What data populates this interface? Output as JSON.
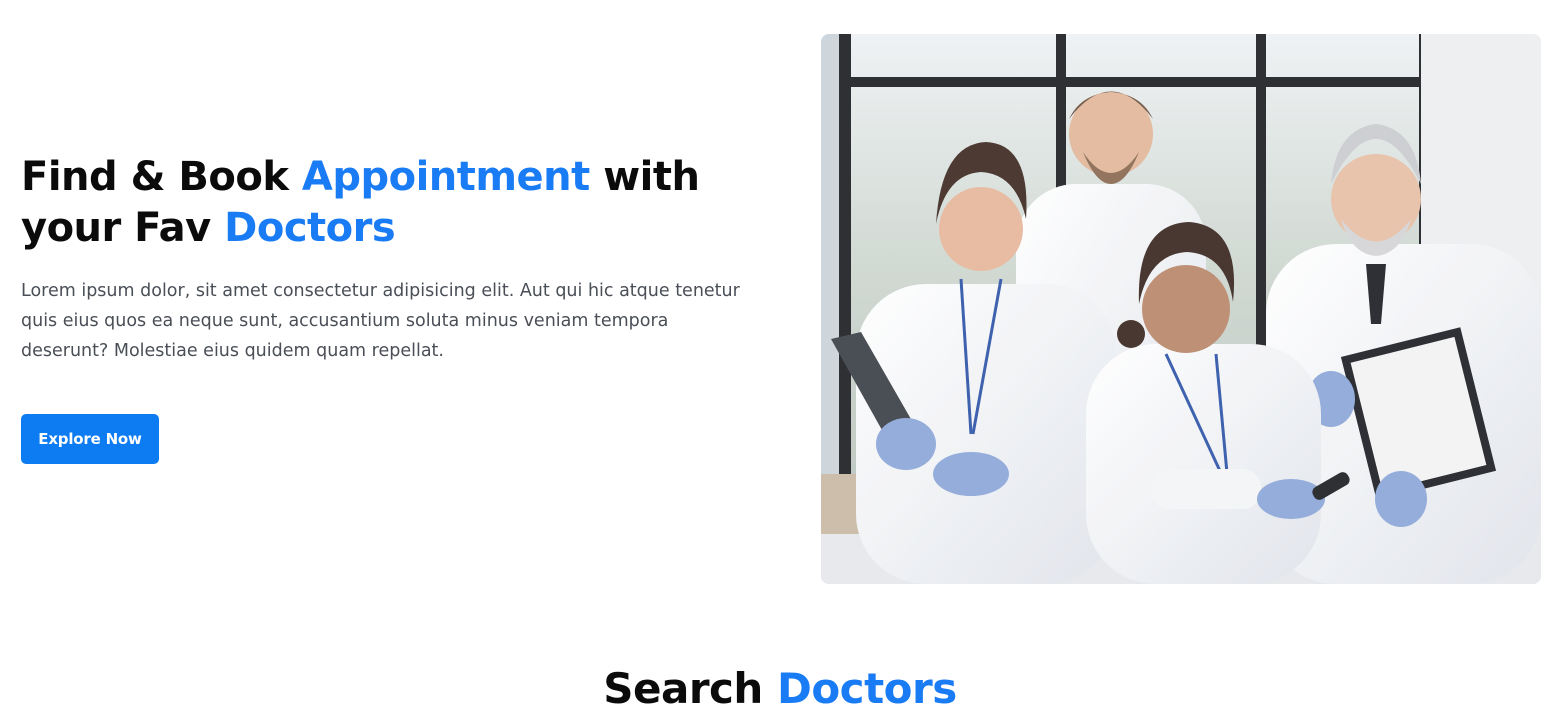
{
  "hero": {
    "title_part1": "Find & Book ",
    "title_accent1": "Appointment",
    "title_part2": " with your Fav ",
    "title_accent2": "Doctors",
    "description": "Lorem ipsum dolor, sit amet consectetur adipisicing elit. Aut qui hic atque tenetur quis eius quos ea neque sunt, accusantium soluta minus veniam tempora deserunt? Molestiae eius quidem quam repellat.",
    "cta_label": "Explore Now",
    "image_subject": "group-of-doctors-photo"
  },
  "search_section": {
    "title_part1": "Search ",
    "title_accent": "Doctors"
  },
  "colors": {
    "accent": "#1a7cf4",
    "button": "#0d7cf2",
    "heading": "#0b0b0b",
    "body_text": "#4a4f57"
  }
}
